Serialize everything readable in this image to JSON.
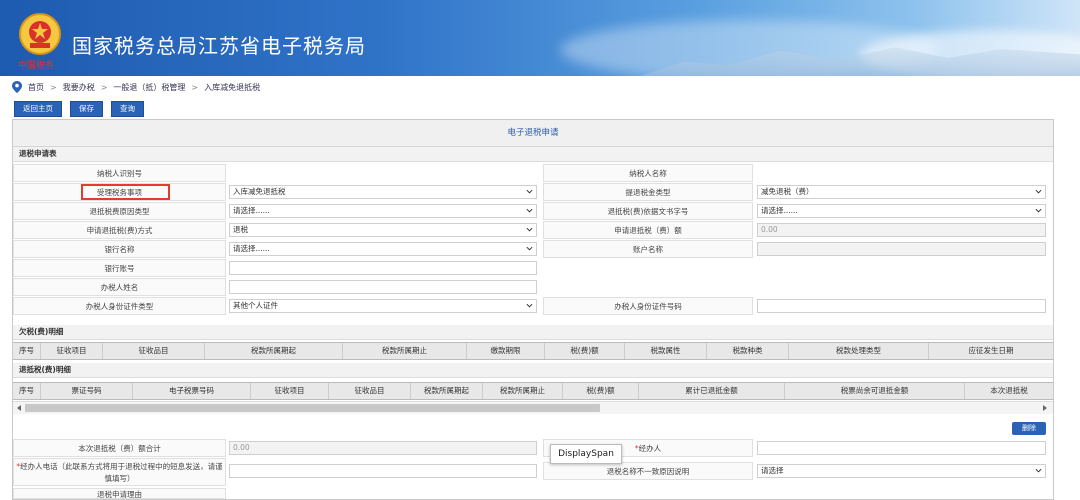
{
  "banner": {
    "title": "国家税务总局江苏省电子税务局",
    "emblem_subtitle": "中国税务"
  },
  "breadcrumb": [
    "首页",
    "我要办税",
    "一般退（抵）税管理",
    "入库减免退抵税"
  ],
  "breadcrumb_sep": ">",
  "toolbar": {
    "home": "返回主页",
    "save": "保存",
    "query": "查询"
  },
  "panel_title": "电子退税申请",
  "section_application": "退税申请表",
  "form": {
    "taxpayer_id_label": "纳税人识别号",
    "taxpayer_name_label": "纳税人名称",
    "matter_label": "受理税务事项",
    "matter_value": "入库减免退抵税",
    "refund_type_label": "提退税金类型",
    "refund_type_value": "减免退税（费）",
    "reason_label": "退抵税费原因类型",
    "reason_value": "请选择......",
    "doc_no_label": "退抵税(费)依据文书字号",
    "doc_no_value": "请选择......",
    "method_label": "申请退抵税(费)方式",
    "method_value": "退税",
    "amount_label": "申请退抵税（费）额",
    "amount_value": "0.00",
    "bank_label": "银行名称",
    "bank_value": "请选择......",
    "account_name_label": "账户名称",
    "account_no_label": "银行账号",
    "agent_name_label": "办税人姓名",
    "agent_id_type_label": "办税人身份证件类型",
    "agent_id_type_value": "其他个人证件",
    "agent_id_no_label": "办税人身份证件号码"
  },
  "section_arrears": "欠税(费)明细",
  "arrears_columns": [
    "序号",
    "征收项目",
    "征收品目",
    "税款所属期起",
    "税款所属期止",
    "缴款期限",
    "税(费)额",
    "税款属性",
    "税款种类",
    "税款处理类型",
    "应征发生日期"
  ],
  "section_refund": "退抵税(费)明细",
  "refund_columns": [
    "序号",
    "票证号码",
    "电子税票号码",
    "征收项目",
    "征收品目",
    "税款所属期起",
    "税款所属期止",
    "税(费)额",
    "累计已退抵金额",
    "税票尚余可退抵金额",
    "本次退抵税"
  ],
  "delete_button": "删除",
  "summary": {
    "total_label": "本次退抵税（费）额合计",
    "total_value": "0.00",
    "handler_label": "经办人",
    "phone_label": "经办人电话（此联系方式将用于退税过程中的短息发送，请谨慎填写）",
    "mismatch_label": "退税名称不一致原因说明",
    "mismatch_value": "请选择",
    "bottom_label": "退税申请理由",
    "required_mark": "*"
  },
  "tooltip": "DisplaySpan"
}
